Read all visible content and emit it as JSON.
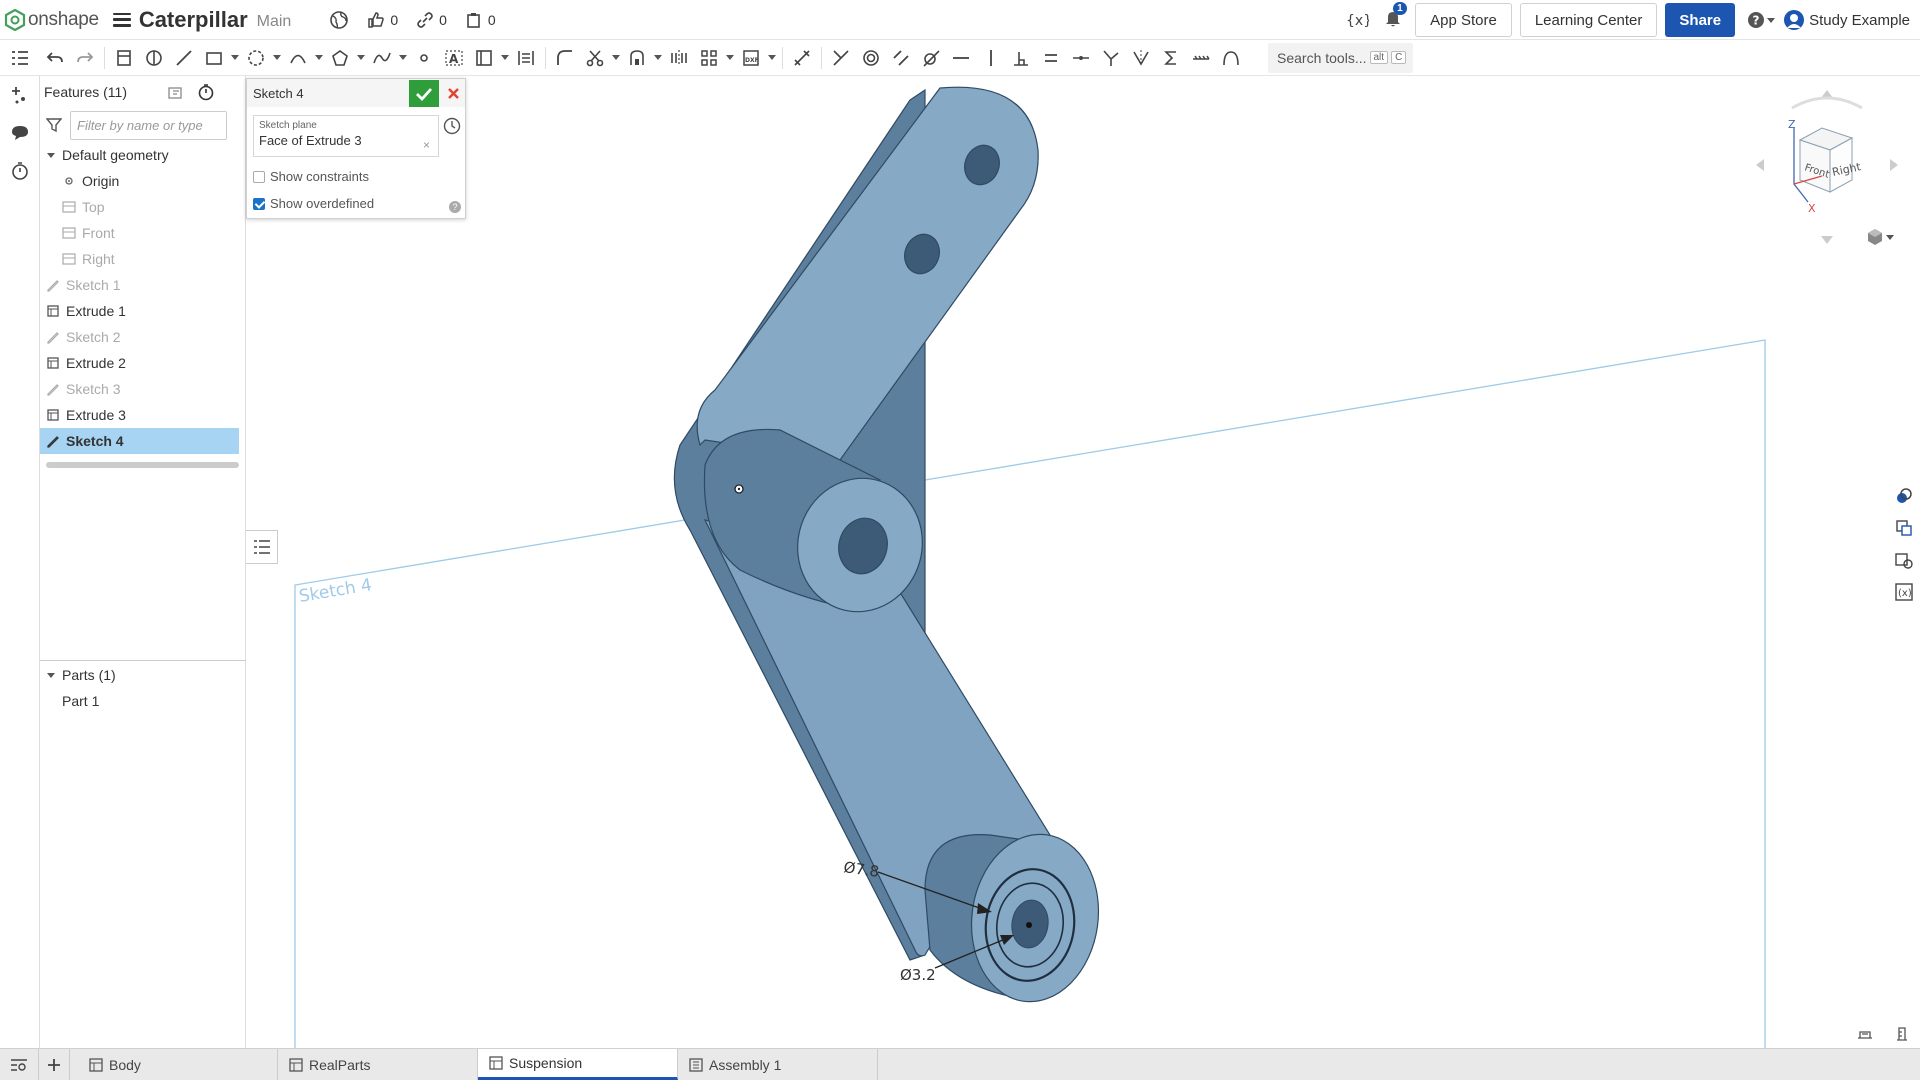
{
  "header": {
    "brand": "onshape",
    "doc_title": "Caterpillar",
    "branch": "Main",
    "likes": "0",
    "links": "0",
    "copies": "0",
    "notifications": "1",
    "app_store": "App Store",
    "learning_center": "Learning Center",
    "share": "Share",
    "user": "Study Example"
  },
  "toolbar": {
    "search_label": "Search tools...",
    "search_key1": "alt",
    "search_key2": "C"
  },
  "features": {
    "title": "Features (11)",
    "filter_placeholder": "Filter by name or type",
    "default_geometry": "Default geometry",
    "items": [
      {
        "label": "Origin"
      },
      {
        "label": "Top"
      },
      {
        "label": "Front"
      },
      {
        "label": "Right"
      },
      {
        "label": "Sketch 1"
      },
      {
        "label": "Extrude 1"
      },
      {
        "label": "Sketch 2"
      },
      {
        "label": "Extrude 2"
      },
      {
        "label": "Sketch 3"
      },
      {
        "label": "Extrude 3"
      },
      {
        "label": "Sketch 4"
      }
    ],
    "parts_title": "Parts (1)",
    "parts": [
      {
        "label": "Part 1"
      }
    ]
  },
  "dialog": {
    "title": "Sketch 4",
    "plane_label": "Sketch plane",
    "plane_value": "Face of Extrude 3",
    "show_constraints": "Show constraints",
    "show_overdefined": "Show overdefined",
    "constraints_checked": false,
    "overdefined_checked": true
  },
  "viewport": {
    "sketch_label": "Sketch 4",
    "dim_outer": "Ø7.8",
    "dim_inner": "Ø3.2",
    "cube_front": "Front",
    "cube_right": "Right",
    "axis_z": "Z",
    "axis_x": "X"
  },
  "tabs": [
    {
      "label": "Body"
    },
    {
      "label": "RealParts"
    },
    {
      "label": "Suspension"
    },
    {
      "label": "Assembly 1"
    }
  ],
  "colors": {
    "accent": "#1c56b0",
    "selection": "#a6d4f2",
    "part_face": "#86a9c6",
    "part_side": "#5c7f9e",
    "confirm": "#2f9e3a",
    "cancel": "#e0442f"
  }
}
